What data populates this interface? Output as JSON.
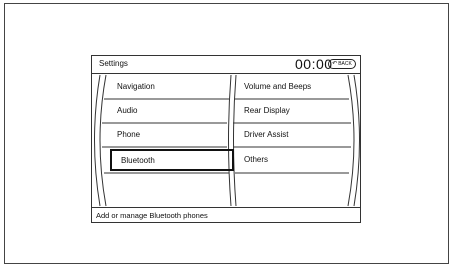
{
  "header": {
    "title": "Settings",
    "clock": "00:00",
    "back_label": "BACK"
  },
  "menu": {
    "left": [
      {
        "label": "Navigation"
      },
      {
        "label": "Audio"
      },
      {
        "label": "Phone"
      },
      {
        "label": "Bluetooth",
        "selected": true
      }
    ],
    "right": [
      {
        "label": "Volume and Beeps"
      },
      {
        "label": "Rear Display"
      },
      {
        "label": "Driver Assist"
      },
      {
        "label": "Others"
      }
    ]
  },
  "status": {
    "text": "Add or manage Bluetooth phones"
  }
}
